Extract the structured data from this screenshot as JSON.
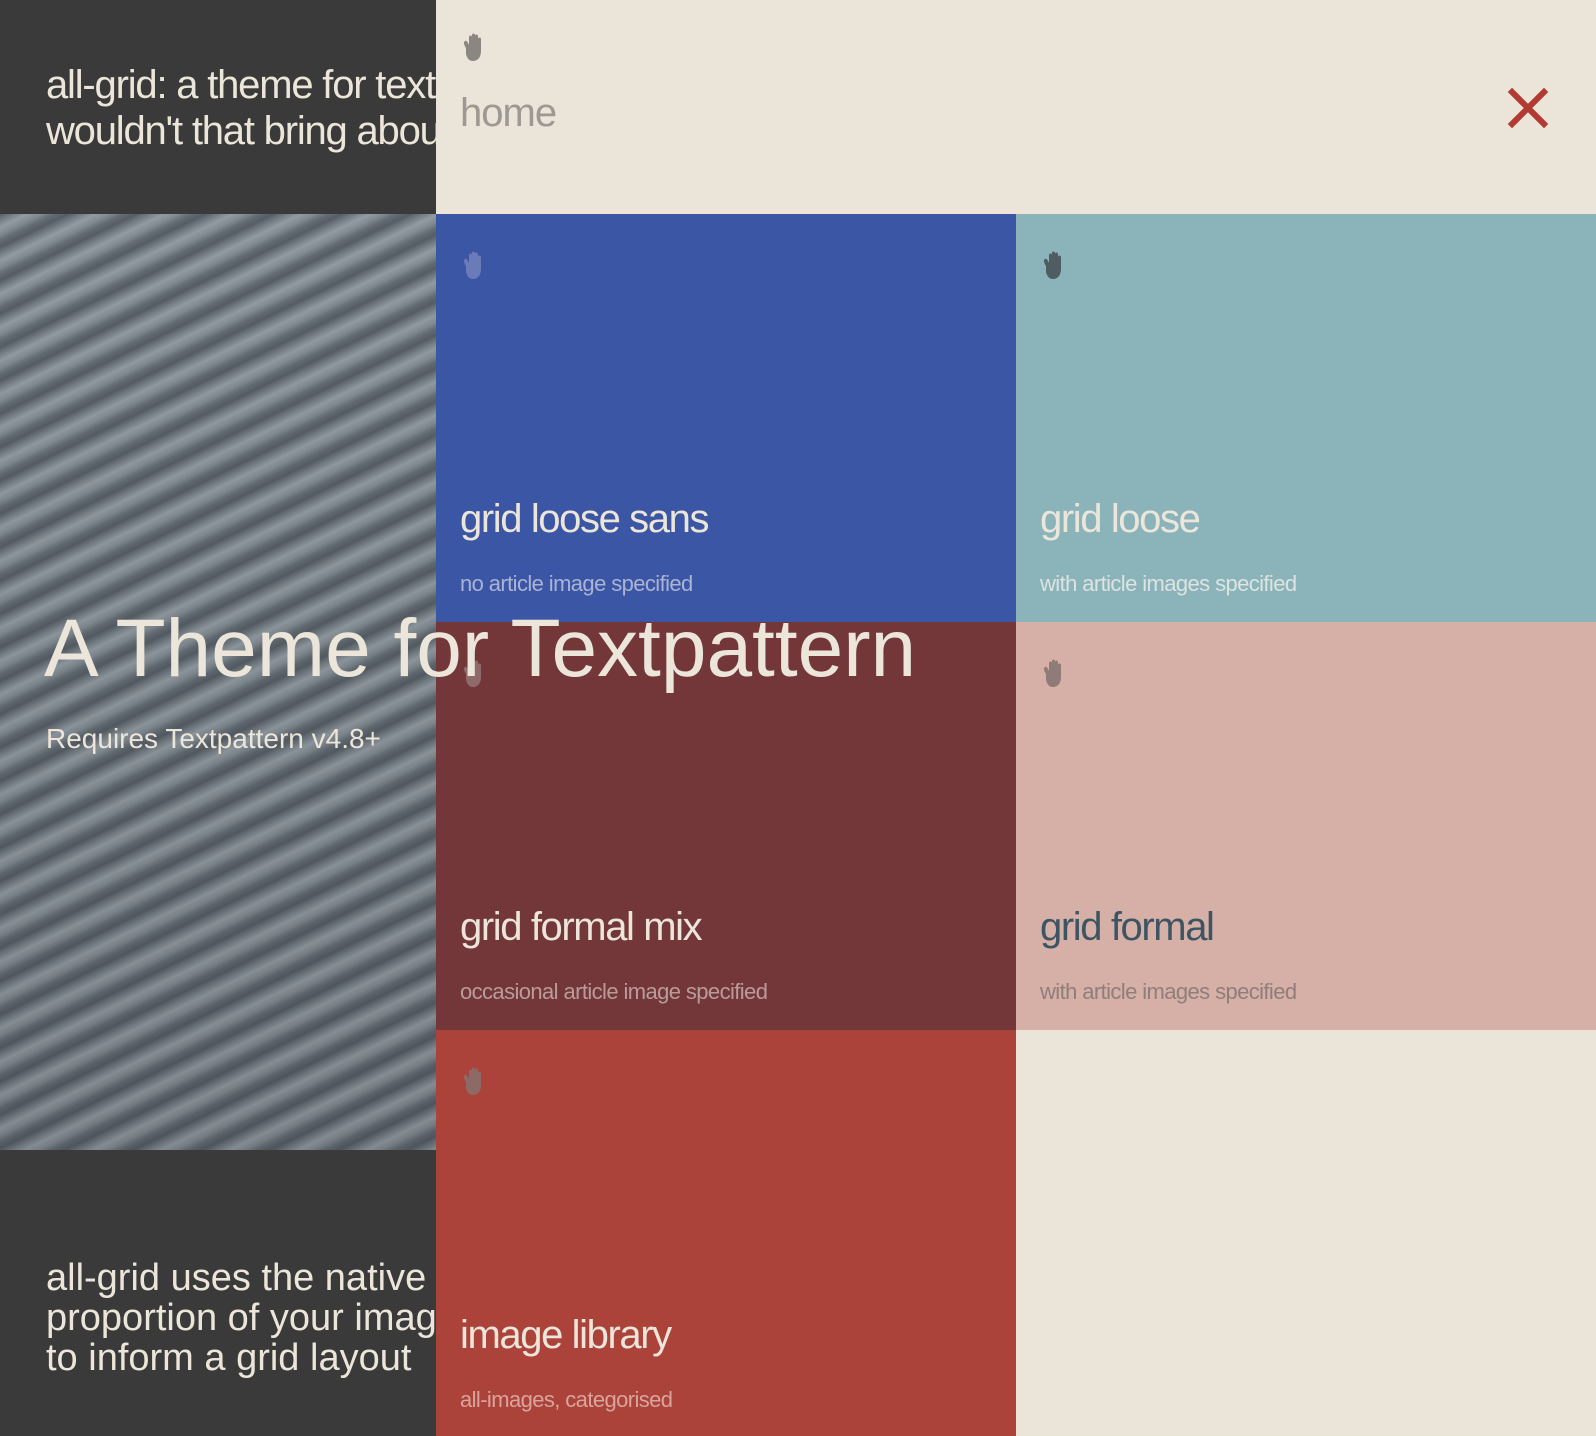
{
  "background_page": {
    "tagline": "all-grid: a theme for textpattern\nwouldn't that bring about",
    "hero_title": "A Theme for Textpattern",
    "hero_subtitle": "Requires Textpattern v4.8+",
    "intro_text": "all-grid uses the native\nproportion of your images\nto inform a grid layout"
  },
  "nav": {
    "home_label": "home",
    "close_icon": "close-icon",
    "hand_icon": "hand-icon",
    "tiles": [
      {
        "title": "grid loose sans",
        "subtitle": "no article image specified",
        "color": "#3b56a4"
      },
      {
        "title": "grid loose",
        "subtitle": "with article images specified",
        "color": "#8bb4ba"
      },
      {
        "title": "grid formal mix",
        "subtitle": "occasional article image specified",
        "color": "#73373a"
      },
      {
        "title": "grid formal",
        "subtitle": "with article images specified",
        "color": "#d6afa6"
      },
      {
        "title": "image library",
        "subtitle": "all-images, categorised",
        "color": "#ac433b"
      }
    ]
  },
  "colors": {
    "panel_bg": "#ebe4d8",
    "dark_bg": "#393a39",
    "cream_text": "#ece6da",
    "close_red": "#b23a33",
    "formal_title": "#3d5563"
  }
}
